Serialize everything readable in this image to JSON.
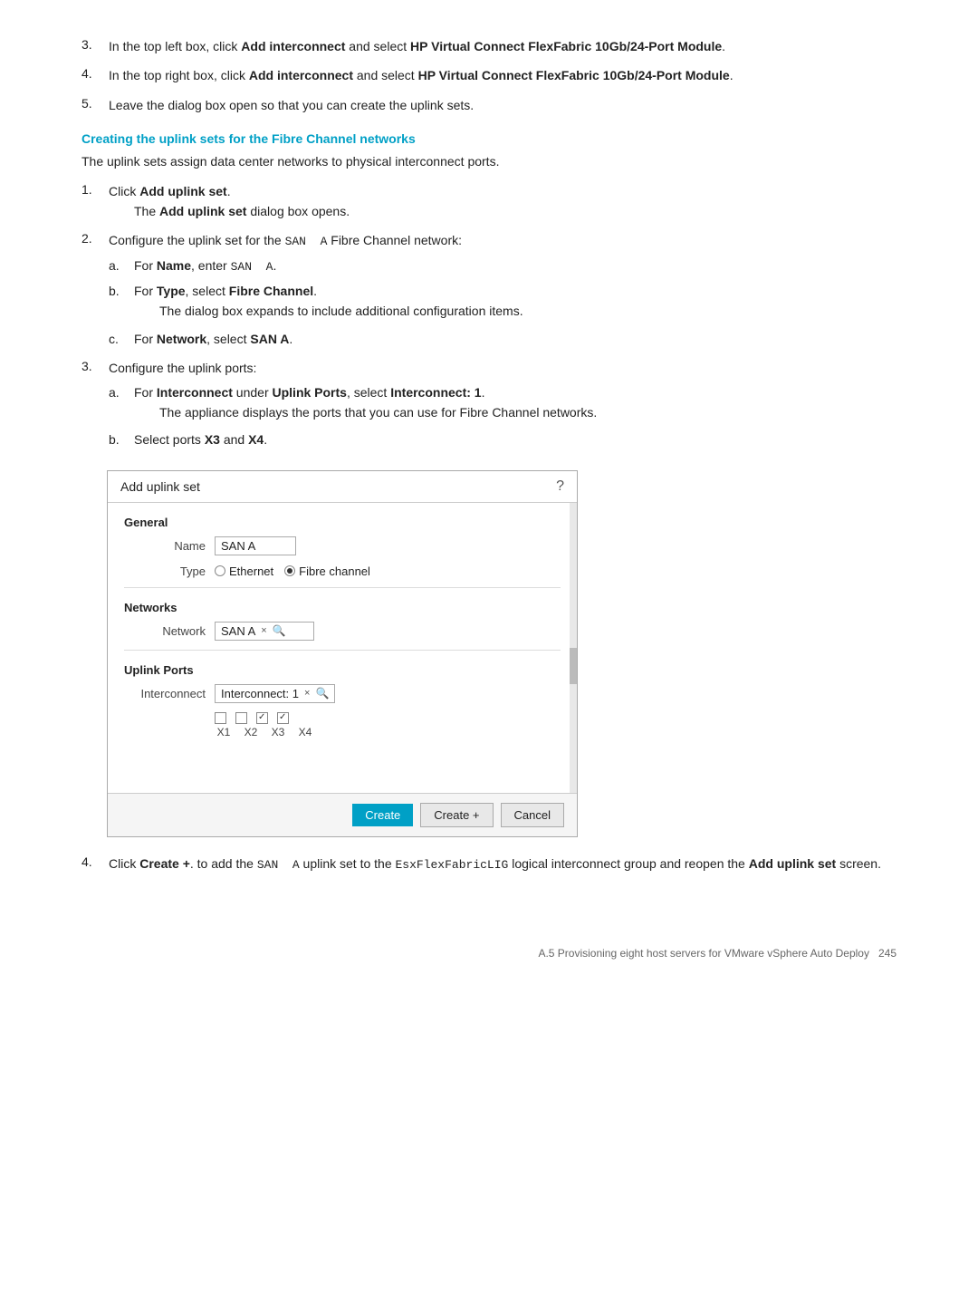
{
  "steps": {
    "step3": {
      "num": "3.",
      "text_before": "In the top left box, click ",
      "link1": "Add interconnect",
      "text_mid": " and select ",
      "bold1": "HP Virtual Connect FlexFabric 10Gb/24-Port Module",
      "bold1_end": "."
    },
    "step4": {
      "num": "4.",
      "text_before": "In the top right box, click ",
      "link1": "Add interconnect",
      "text_mid": " and select ",
      "bold1": "HP Virtual Connect FlexFabric 10Gb/24-Port Module",
      "bold1_end": "."
    },
    "step5": {
      "num": "5.",
      "text": "Leave the dialog box open so that you can create the uplink sets."
    }
  },
  "section_heading": "Creating the uplink sets for the Fibre Channel networks",
  "section_intro": "The uplink sets assign data center networks to physical interconnect ports.",
  "sub_steps": {
    "step1": {
      "num": "1.",
      "bold": "Add uplink set",
      "suffix": ".",
      "note": "The ",
      "note_bold": "Add uplink set",
      "note_suffix": " dialog box opens."
    },
    "step2": {
      "num": "2.",
      "text": "Configure the uplink set for the ",
      "mono": "SAN A",
      "text2": " Fibre Channel network:",
      "sub_a": {
        "letter": "a.",
        "label": "Name",
        "value": "SAN A",
        "mono_value": "SAN A"
      },
      "sub_b": {
        "letter": "b.",
        "label": "Type",
        "value": "Fibre Channel",
        "note": "The dialog box expands to include additional configuration items."
      },
      "sub_c": {
        "letter": "c.",
        "label": "Network",
        "value": "SAN A"
      }
    },
    "step3": {
      "num": "3.",
      "text": "Configure the uplink ports:",
      "sub_a": {
        "letter": "a.",
        "label": "Interconnect",
        "label2": "Uplink Ports",
        "value": "Interconnect: 1",
        "note": "The appliance displays the ports that you can use for Fibre Channel networks."
      },
      "sub_b": {
        "letter": "b.",
        "text_before": "Select ports ",
        "x3": "X3",
        "and": " and ",
        "x4": "X4",
        "suffix": "."
      }
    }
  },
  "dialog": {
    "title": "Add uplink set",
    "help_char": "?",
    "general_label": "General",
    "name_label": "Name",
    "name_value": "SAN A",
    "type_label": "Type",
    "type_option1": "Ethernet",
    "type_option2": "Fibre channel",
    "networks_label": "Networks",
    "network_label": "Network",
    "network_value": "SAN A",
    "uplink_ports_label": "Uplink Ports",
    "interconnect_label": "Interconnect",
    "interconnect_value": "Interconnect: 1",
    "ports": [
      "X1",
      "X2",
      "X3",
      "X4"
    ],
    "port_checked": [
      false,
      false,
      true,
      true
    ],
    "btn_create": "Create",
    "btn_create_plus": "Create +",
    "btn_cancel": "Cancel"
  },
  "step4_final": {
    "num": "4.",
    "text_before": "Click ",
    "bold": "Create +",
    "text_mid": ". to add the ",
    "mono": "SAN A",
    "text_after": " uplink set to the ",
    "mono2": "EsxFlexFabricLIG",
    "text_end": " logical interconnect group and reopen the ",
    "bold2": "Add uplink set",
    "text_final": " screen."
  },
  "footer": {
    "text": "A.5 Provisioning eight host servers for VMware vSphere Auto Deploy",
    "page": "245"
  }
}
